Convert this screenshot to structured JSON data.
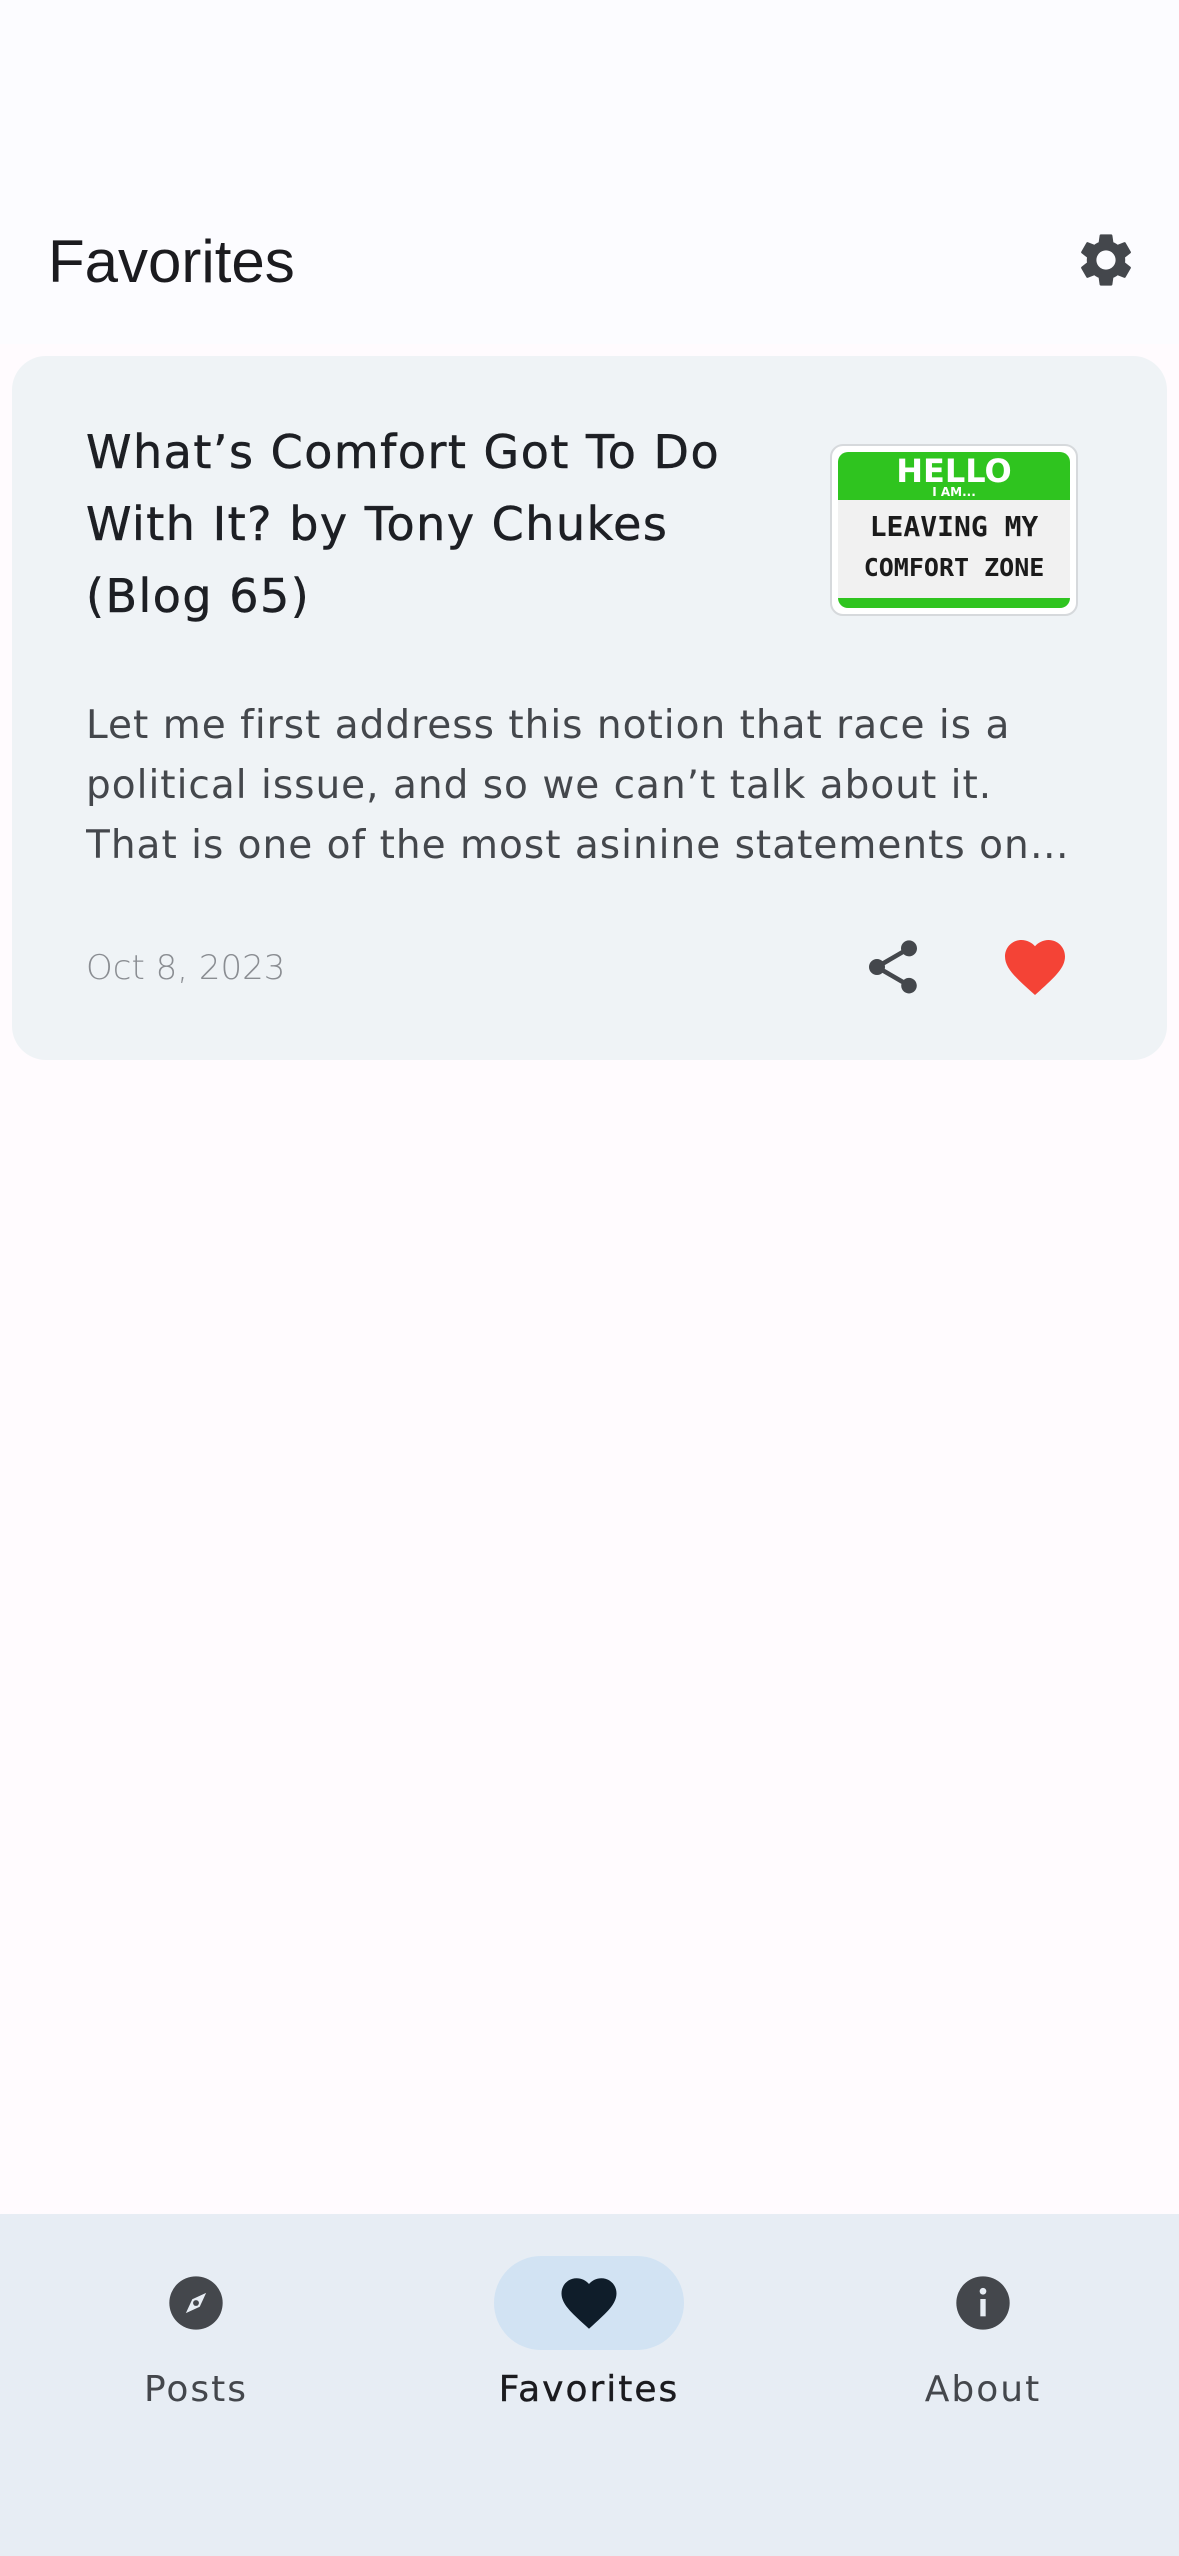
{
  "app_bar": {
    "title": "Favorites",
    "settings_icon": "gear-icon"
  },
  "post": {
    "title": "What’s Comfort Got To Do With It? by Tony Chukes (Blog 65)",
    "excerpt": "Let me first address this notion that race is a political issue, and so we can’t talk about it. That is one of the most asinine statements on earth.",
    "date": "Oct 8, 2023",
    "thumbnail": {
      "line1": "HELLO",
      "line2": "I AM...",
      "line3": "LEAVING MY",
      "line4": "COMFORT ZONE"
    },
    "share_icon": "share-icon",
    "favorite_icon": "heart-icon",
    "favorited": true
  },
  "bottom_nav": {
    "items": [
      {
        "label": "Posts",
        "icon": "compass-icon",
        "active": false
      },
      {
        "label": "Favorites",
        "icon": "heart-icon",
        "active": true
      },
      {
        "label": "About",
        "icon": "info-icon",
        "active": false
      }
    ]
  },
  "colors": {
    "accent_pill": "#d2e3f3",
    "favorite_red": "#f44336",
    "card_bg": "#eff3f6",
    "nav_bg": "#e7edf4",
    "thumb_green": "#2fc41f"
  }
}
